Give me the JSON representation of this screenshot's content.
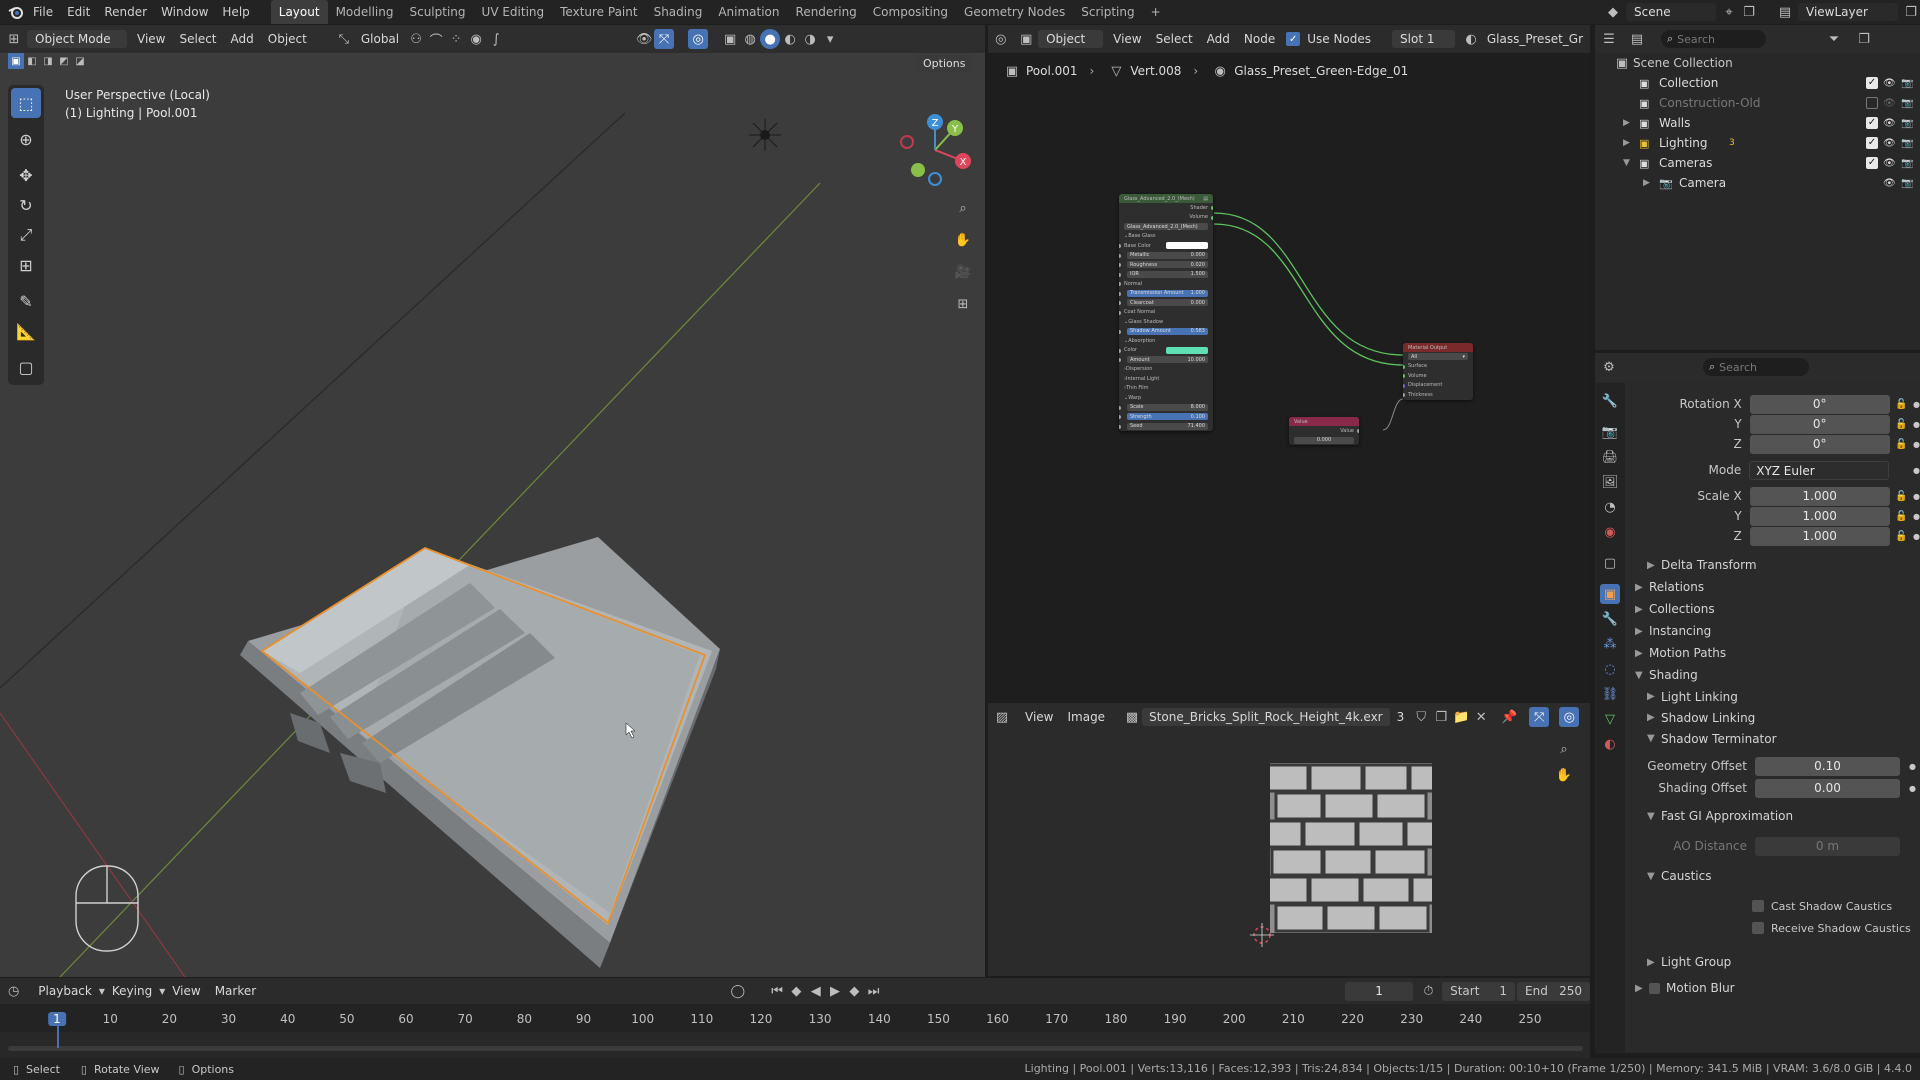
{
  "topbar": {
    "menus": [
      "File",
      "Edit",
      "Render",
      "Window",
      "Help"
    ],
    "workspaces": [
      "Layout",
      "Modelling",
      "Sculpting",
      "UV Editing",
      "Texture Paint",
      "Shading",
      "Animation",
      "Rendering",
      "Compositing",
      "Geometry Nodes",
      "Scripting"
    ],
    "active_workspace": "Layout",
    "add_tab": "+",
    "scene_label": "Scene",
    "viewlayer_label": "ViewLayer"
  },
  "viewport": {
    "mode": "Object Mode",
    "menus": [
      "View",
      "Select",
      "Add",
      "Object"
    ],
    "transform_orientation": "Global",
    "options_label": "Options",
    "info_line1": "User Perspective (Local)",
    "info_line2": "(1) Lighting | Pool.001",
    "gizmo_axes": {
      "x": "X",
      "y": "Y",
      "z": "Z"
    }
  },
  "node_editor": {
    "object_mode": "Object",
    "menus": [
      "View",
      "Select",
      "Add",
      "Node"
    ],
    "use_nodes_label": "Use Nodes",
    "slot": "Slot 1",
    "material_name": "Glass_Preset_Gr",
    "breadcrumb": [
      "Pool.001",
      "Vert.008",
      "Glass_Preset_Green-Edge_01"
    ],
    "group_node": {
      "title": "Glass_Advanced_2.0_(Mesh)",
      "sub": "Glass_Advanced_2.0_(Mesh)",
      "outputs": [
        "Shader",
        "Volume"
      ],
      "rows": [
        {
          "label": "Base Glass",
          "kind": "section"
        },
        {
          "label": "Base Color",
          "kind": "color",
          "color": "#ffffff"
        },
        {
          "label": "Metallic",
          "kind": "field",
          "value": "0.000"
        },
        {
          "label": "Roughness",
          "kind": "field",
          "value": "0.020"
        },
        {
          "label": "IOR",
          "kind": "field",
          "value": "1.500"
        },
        {
          "label": "Normal",
          "kind": "plain"
        },
        {
          "label": "Transmission Amount",
          "kind": "blue",
          "value": "1.000"
        },
        {
          "label": "Clearcoat",
          "kind": "field",
          "value": "0.000"
        },
        {
          "label": "Coat Normal",
          "kind": "plain"
        },
        {
          "label": "Glass Shadow",
          "kind": "section"
        },
        {
          "label": "Shadow Amount",
          "kind": "blue",
          "value": "0.583"
        },
        {
          "label": "Absorption",
          "kind": "section"
        },
        {
          "label": "Color",
          "kind": "color",
          "color": "#5fe0b4"
        },
        {
          "label": "Amount",
          "kind": "field",
          "value": "10.000"
        },
        {
          "label": "Dispersion",
          "kind": "collapsed"
        },
        {
          "label": "Internal Light",
          "kind": "collapsed"
        },
        {
          "label": "Thin Film",
          "kind": "collapsed"
        },
        {
          "label": "Warp",
          "kind": "section"
        },
        {
          "label": "Scale",
          "kind": "field",
          "value": "8.000"
        },
        {
          "label": "Strength",
          "kind": "blue",
          "value": "0.100"
        },
        {
          "label": "Seed",
          "kind": "field",
          "value": "71.400"
        }
      ]
    },
    "output_node": {
      "title": "Material Output",
      "target": "All",
      "inputs": [
        "Surface",
        "Volume",
        "Displacement",
        "Thickness"
      ]
    },
    "value_node": {
      "title": "Value",
      "output": "Value",
      "value": "0.000"
    }
  },
  "image_editor": {
    "menus": [
      "View",
      "Image"
    ],
    "image_name": "Stone_Bricks_Split_Rock_Height_4k.exr",
    "users": "3"
  },
  "outliner": {
    "search_placeholder": "Search",
    "root": "Scene Collection",
    "items": [
      {
        "label": "Collection",
        "indent": 1,
        "expandable": false,
        "checked": true,
        "dim": false
      },
      {
        "label": "Construction-Old",
        "indent": 1,
        "expandable": false,
        "checked": false,
        "dim": true
      },
      {
        "label": "Walls",
        "indent": 1,
        "expandable": true,
        "checked": true,
        "dim": false
      },
      {
        "label": "Lighting",
        "indent": 1,
        "expandable": true,
        "checked": true,
        "dim": false,
        "badge": "3"
      },
      {
        "label": "Cameras",
        "indent": 1,
        "expandable": true,
        "open": true,
        "checked": true,
        "dim": false
      },
      {
        "label": "Camera",
        "indent": 2,
        "expandable": true,
        "checked": null,
        "dim": false
      }
    ]
  },
  "properties": {
    "search_placeholder": "Search",
    "rotation": {
      "x_label": "Rotation X",
      "y_label": "Y",
      "z_label": "Z",
      "x": "0°",
      "y": "0°",
      "z": "0°"
    },
    "mode_label": "Mode",
    "mode_value": "XYZ Euler",
    "scale": {
      "x_label": "Scale X",
      "y_label": "Y",
      "z_label": "Z",
      "x": "1.000",
      "y": "1.000",
      "z": "1.000"
    },
    "panels": [
      "Delta Transform",
      "Relations",
      "Collections",
      "Instancing",
      "Motion Paths"
    ],
    "shading_label": "Shading",
    "shading_sub": [
      "Light Linking",
      "Shadow Linking"
    ],
    "shadow_terminator_label": "Shadow Terminator",
    "geometry_offset_label": "Geometry Offset",
    "geometry_offset": "0.10",
    "shading_offset_label": "Shading Offset",
    "shading_offset": "0.00",
    "fast_gi_label": "Fast GI Approximation",
    "ao_distance_label": "AO Distance",
    "ao_distance": "0 m",
    "caustics_label": "Caustics",
    "cast_shadow_caustics": "Cast Shadow Caustics",
    "receive_shadow_caustics": "Receive Shadow Caustics",
    "light_group": "Light Group",
    "motion_blur": "Motion Blur"
  },
  "timeline": {
    "menus": [
      "Playback",
      "Keying",
      "View",
      "Marker"
    ],
    "current_frame": "1",
    "start_label": "Start",
    "start": "1",
    "end_label": "End",
    "end": "250",
    "ticks": [
      "1",
      "10",
      "20",
      "30",
      "40",
      "50",
      "60",
      "70",
      "80",
      "90",
      "100",
      "110",
      "120",
      "130",
      "140",
      "150",
      "160",
      "170",
      "180",
      "190",
      "200",
      "210",
      "220",
      "230",
      "240",
      "250"
    ]
  },
  "statusbar": {
    "hint_select": "Select",
    "hint_rotate": "Rotate View",
    "hint_options": "Options",
    "stats": "Lighting | Pool.001 | Verts:13,116 | Faces:12,393 | Tris:24,834 | Objects:1/15 | Duration: 00:10+10 (Frame 1/250) | Memory: 341.5 MiB | VRAM: 3.6/8.0 GiB | 4.4.0"
  },
  "colors": {
    "accent": "#4772b3",
    "selection_outline": "#e8902e",
    "x_axis": "#e0465a",
    "y_axis": "#8ac04a",
    "z_axis": "#3f8fd6"
  }
}
